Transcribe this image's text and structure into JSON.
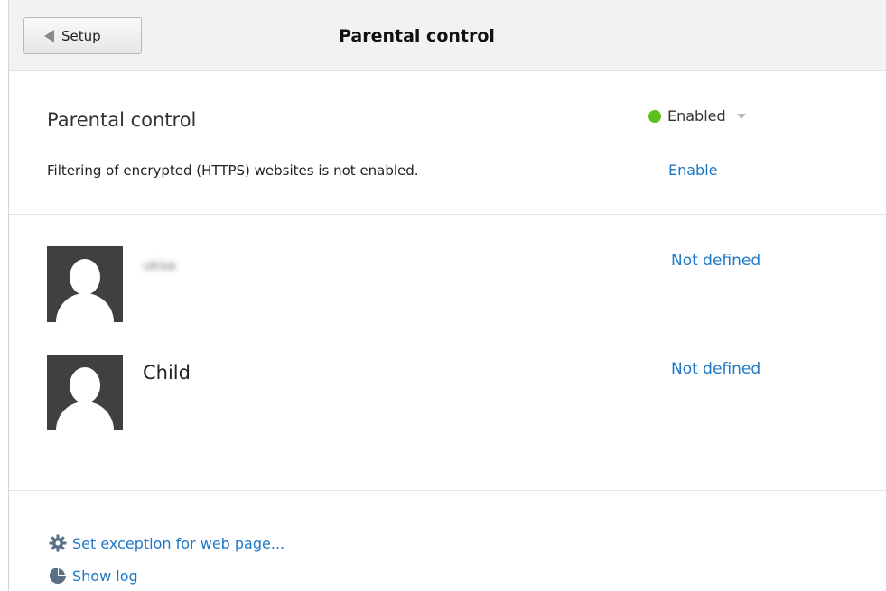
{
  "header": {
    "back_label": "Setup",
    "title": "Parental control"
  },
  "main": {
    "feature_label": "Parental control",
    "status_label": "Enabled",
    "status_color": "#5fbf1a",
    "https_note": "Filtering of encrypted (HTTPS) websites is not enabled.",
    "enable_link": "Enable"
  },
  "users": [
    {
      "name": "ukisa",
      "status": "Not defined",
      "avatar_icon": "user-avatar-icon"
    },
    {
      "name": "Child",
      "status": "Not defined",
      "avatar_icon": "user-avatar-icon"
    }
  ],
  "actions": {
    "exception_label": "Set exception for web page...",
    "exception_icon": "gear-icon",
    "log_label": "Show log",
    "log_icon": "pie-chart-icon"
  },
  "colors": {
    "link": "#1e78c8",
    "header_bg": "#f0f2f4"
  }
}
